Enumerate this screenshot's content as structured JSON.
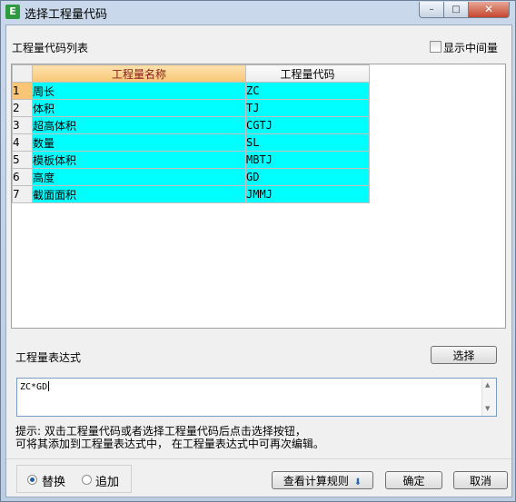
{
  "window": {
    "icon": "app-logo-icon",
    "title": "选择工程量代码",
    "controls": {
      "minimize": "minimize-icon",
      "maximize": "maximize-icon",
      "close": "close-icon"
    }
  },
  "list": {
    "label": "工程量代码列表",
    "show_middle_label": "显示中间量",
    "show_middle_checked": false,
    "columns": {
      "name": "工程量名称",
      "code": "工程量代码"
    },
    "rows": [
      {
        "num": "1",
        "name": "周长",
        "code": "ZC"
      },
      {
        "num": "2",
        "name": "体积",
        "code": "TJ"
      },
      {
        "num": "3",
        "name": "超高体积",
        "code": "CGTJ"
      },
      {
        "num": "4",
        "name": "数量",
        "code": "SL"
      },
      {
        "num": "5",
        "name": "模板体积",
        "code": "MBTJ"
      },
      {
        "num": "6",
        "name": "高度",
        "code": "GD"
      },
      {
        "num": "7",
        "name": "截面面积",
        "code": "JMMJ"
      }
    ],
    "highlight_color": "#00ffff"
  },
  "expression": {
    "label": "工程量表达式",
    "select_button": "选择",
    "value": "ZC*GD"
  },
  "hint": {
    "line1": "提示: 双击工程量代码或者选择工程量代码后点击选择按钮，",
    "line2": "可将其添加到工程量表达式中， 在工程量表达式中可再次编辑。"
  },
  "mode": {
    "replace_label": "替换",
    "append_label": "追加",
    "selected": "替换"
  },
  "footer": {
    "rules_button": "查看计算规则",
    "ok_button": "确定",
    "cancel_button": "取消"
  }
}
